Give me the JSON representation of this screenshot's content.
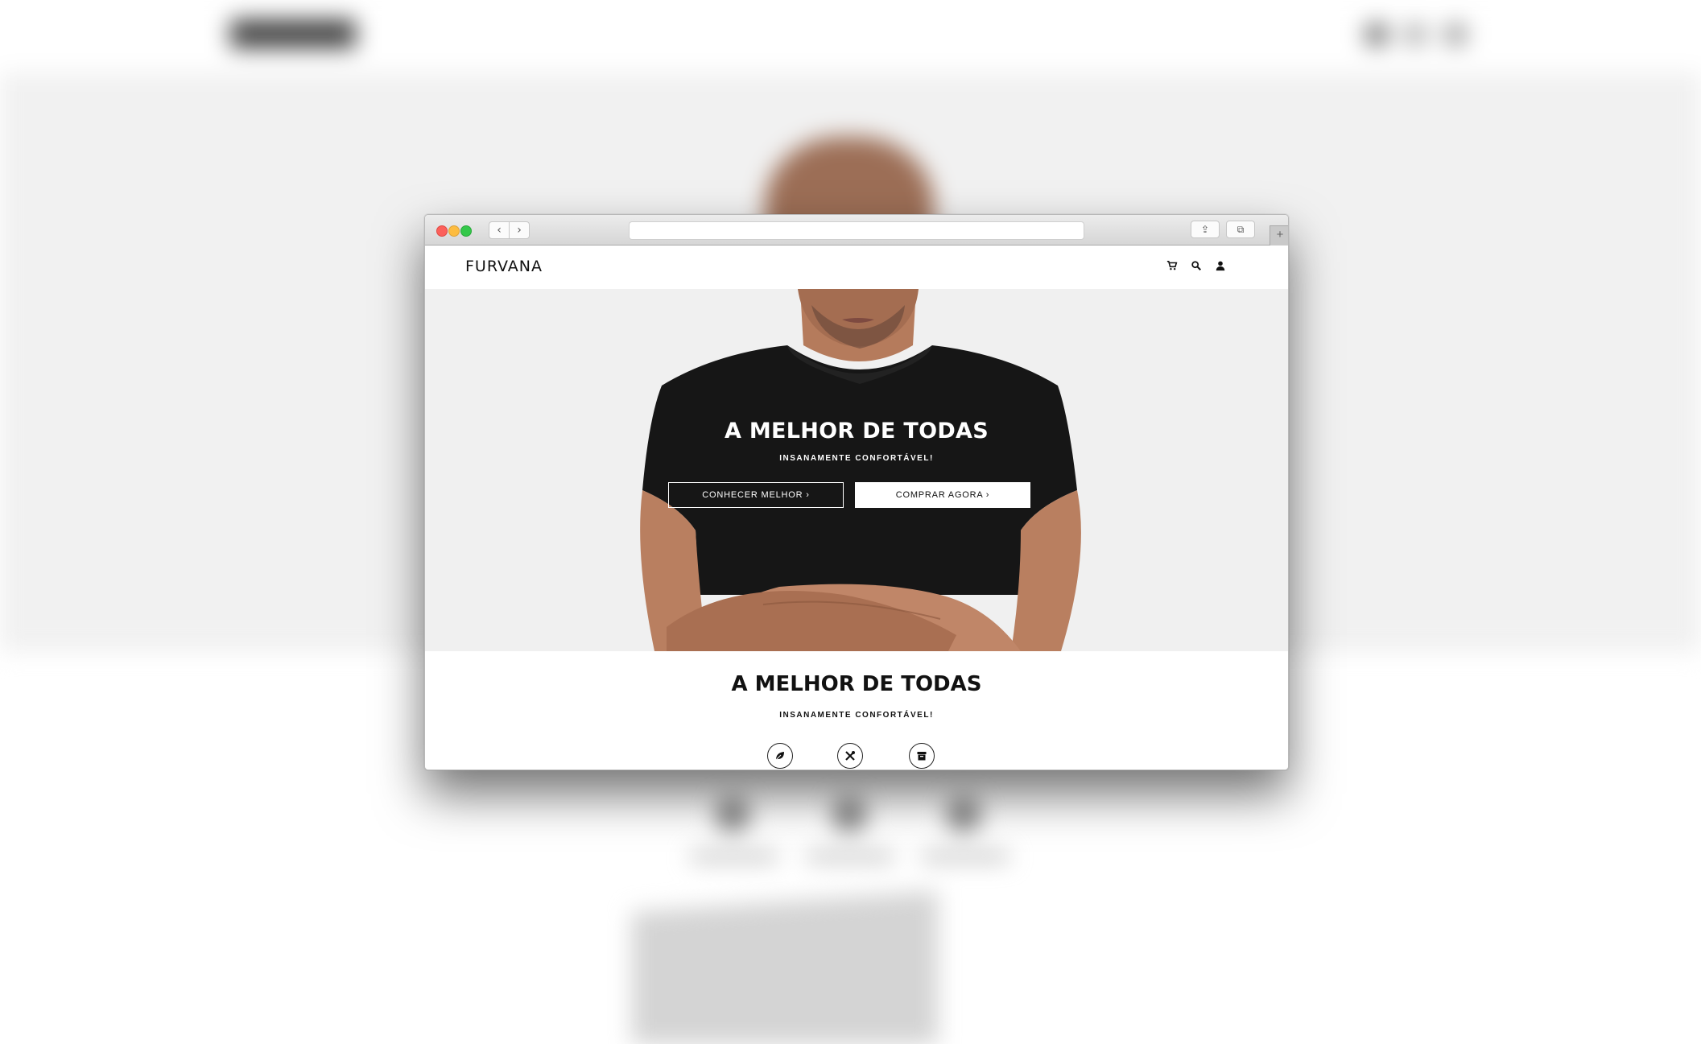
{
  "site": {
    "logo": "FURVANA",
    "header_icons": [
      "cart-icon",
      "search-icon",
      "user-icon"
    ]
  },
  "hero": {
    "title": "A MELHOR DE TODAS",
    "subtitle": "INSANAMENTE CONFORTÁVEL!",
    "primary_button": "CONHECER MELHOR ›",
    "secondary_button": "COMPRAR AGORA ›"
  },
  "section": {
    "title": "A MELHOR DE TODAS",
    "subtitle": "INSANAMENTE CONFORTÁVEL!",
    "feature_icons": [
      "leaf-icon",
      "tools-icon",
      "archive-box-icon"
    ]
  },
  "browser": {
    "back_glyph": "‹",
    "forward_glyph": "›",
    "share_glyph": "⇪",
    "tabs_glyph": "⧉",
    "new_tab_glyph": "+"
  },
  "colors": {
    "hero_background": "#f0f0f0",
    "shirt": "#161616",
    "skin": "#b57b5c",
    "text": "#111111"
  }
}
